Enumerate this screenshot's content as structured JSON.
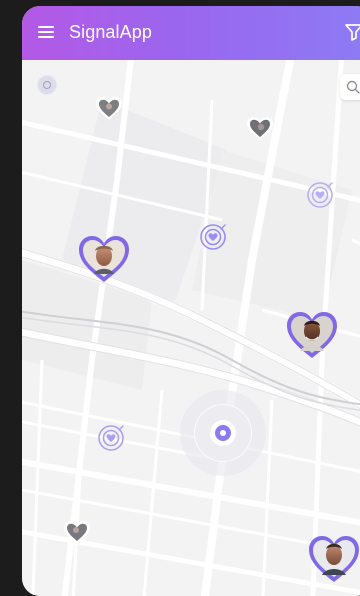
{
  "app": {
    "title": "SignalApp"
  },
  "icons": {
    "menu": "hamburger-menu-icon",
    "filter": "filter-funnel-icon",
    "search": "search-icon",
    "locate": "locate-icon",
    "target": "target-heart-icon",
    "profile_marker": "heart-profile-marker-icon",
    "current_location": "current-location-icon"
  },
  "colors": {
    "brand_start": "#b359e6",
    "brand_end": "#8c7cf4",
    "accent": "#8a7cf0",
    "map_bg": "#f3f3f4"
  }
}
